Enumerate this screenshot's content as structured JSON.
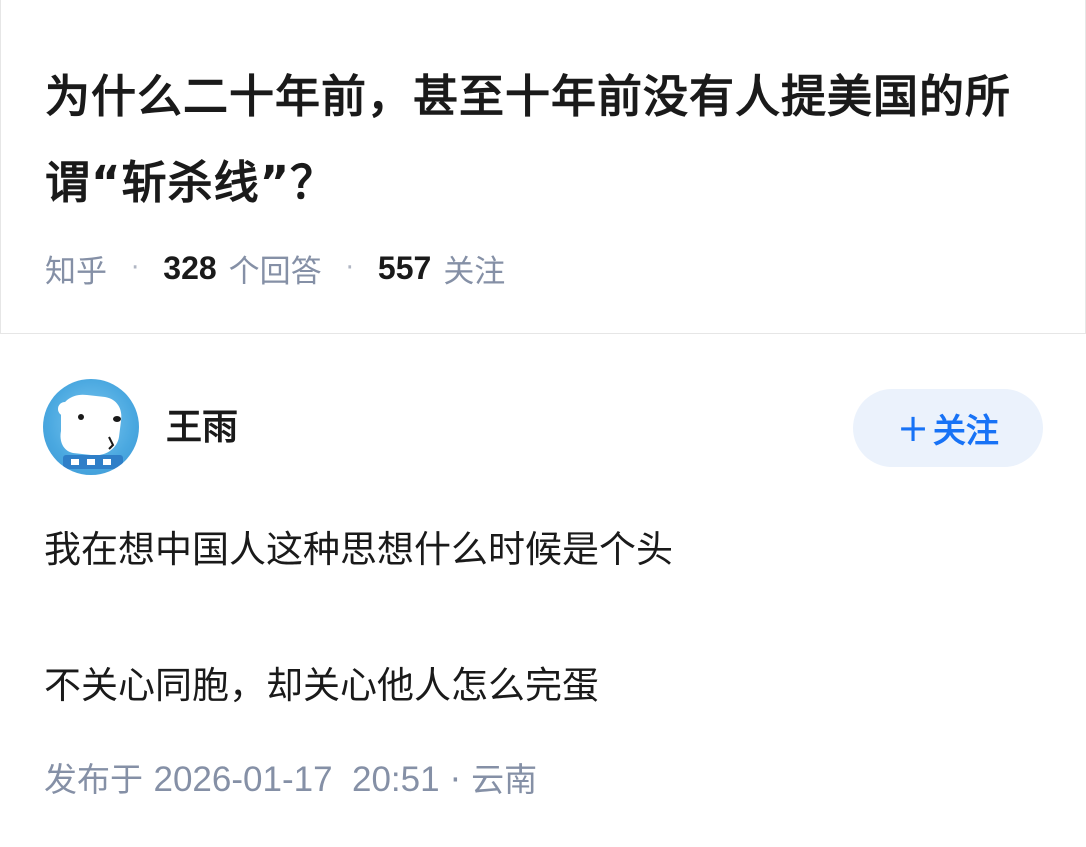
{
  "question": {
    "title": "为什么二十年前，甚至十年前没有人提美国的所谓“斩杀线”？",
    "source": "知乎",
    "answer_count": "328",
    "answer_label": "个回答",
    "follow_count": "557",
    "follow_label": "关注",
    "separator": "·"
  },
  "answer": {
    "author": {
      "name": "王雨",
      "avatar_icon": "polar-bear-avatar"
    },
    "follow_button": {
      "plus": "+",
      "label": "关注"
    },
    "paragraphs": [
      "我在想中国人这种思想什么时候是个头",
      "不关心同胞，却关心他人怎么完蛋"
    ],
    "publish": {
      "prefix": "发布于",
      "datetime": "2026-01-17  20:51",
      "separator": "·",
      "location": "云南"
    }
  },
  "colors": {
    "accent": "#1772f6",
    "follow_bg": "#ebf2fc",
    "meta_gray": "#8590a6",
    "text": "#1a1a1a"
  }
}
